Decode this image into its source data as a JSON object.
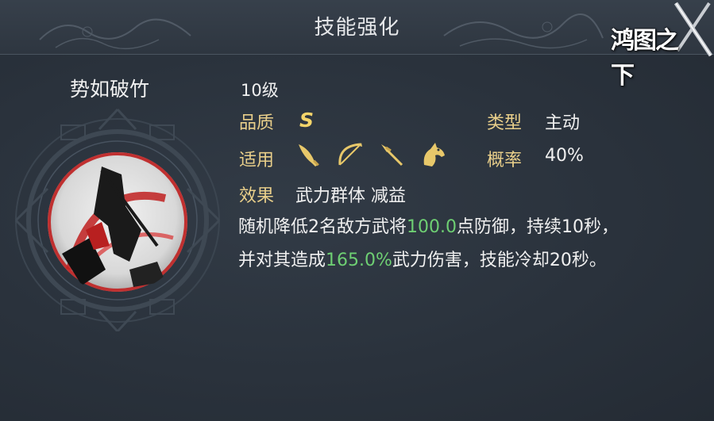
{
  "header": {
    "title": "技能强化",
    "logo_text": "鸿图之下"
  },
  "skill": {
    "name": "势如破竹",
    "level": "10级",
    "quality_label": "品质",
    "quality_value": "S",
    "type_label": "类型",
    "type_value": "主动",
    "applies_label": "适用",
    "applies_icons": [
      "saber-icon",
      "bow-icon",
      "spear-icon",
      "horse-icon"
    ],
    "rate_label": "概率",
    "rate_value": "40%",
    "effect_label": "效果",
    "effect_value": "武力群体 减益",
    "desc_line1_pre": "随机降低2名敌方武将",
    "desc_line1_hl": "100.0",
    "desc_line1_post": "点防御，持续10秒，",
    "desc_line2_pre": "并对其造成",
    "desc_line2_hl": "165.0%",
    "desc_line2_post": "武力伤害，技能冷却20秒。"
  },
  "colors": {
    "background": "#2a323c",
    "label_gold": "#e9cf8a",
    "grade_gold": "#f4d46a",
    "highlight_green": "#6ecf73",
    "text": "#f0f0f0"
  }
}
